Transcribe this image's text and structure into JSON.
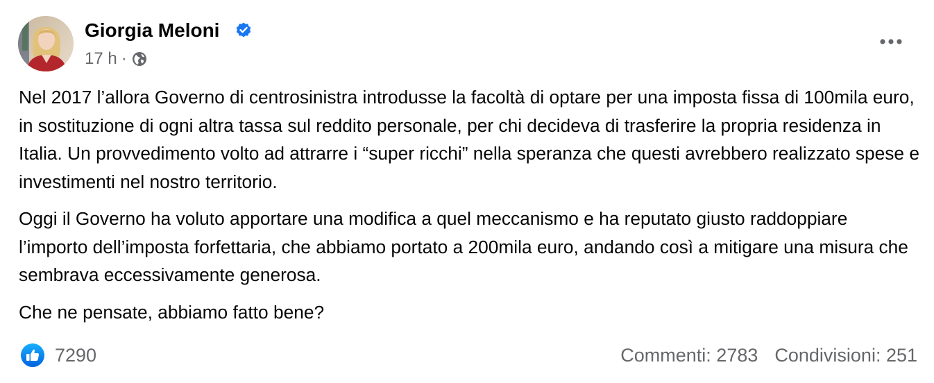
{
  "author": {
    "name": "Giorgia Meloni",
    "verified": true
  },
  "meta": {
    "time": "17 h",
    "separator": "·",
    "audience_icon": "globe-icon"
  },
  "post": {
    "paragraphs": [
      "Nel 2017 l’allora Governo di centrosinistra introdusse la facoltà di optare per una imposta fissa di 100mila euro, in sostituzione di ogni altra tassa sul reddito personale, per chi decideva di trasferire la propria residenza in Italia. Un provvedimento volto ad attrarre i “super ricchi” nella speranza che questi avrebbero realizzato spese e investimenti nel nostro territorio.",
      "Oggi il Governo ha voluto apportare una modifica a quel meccanismo e ha reputato giusto raddoppiare l’importo dell’imposta forfettaria, che abbiamo portato a 200mila euro, andando così a mitigare una misura che sembrava eccessivamente generosa.",
      "Che ne pensate, abbiamo fatto bene?"
    ]
  },
  "engagement": {
    "reactions": "7290",
    "comments": "Commenti: 2783",
    "shares": "Condivisioni: 251"
  },
  "colors": {
    "text": "#050505",
    "secondary": "#65676b",
    "accent": "#1877f2"
  }
}
